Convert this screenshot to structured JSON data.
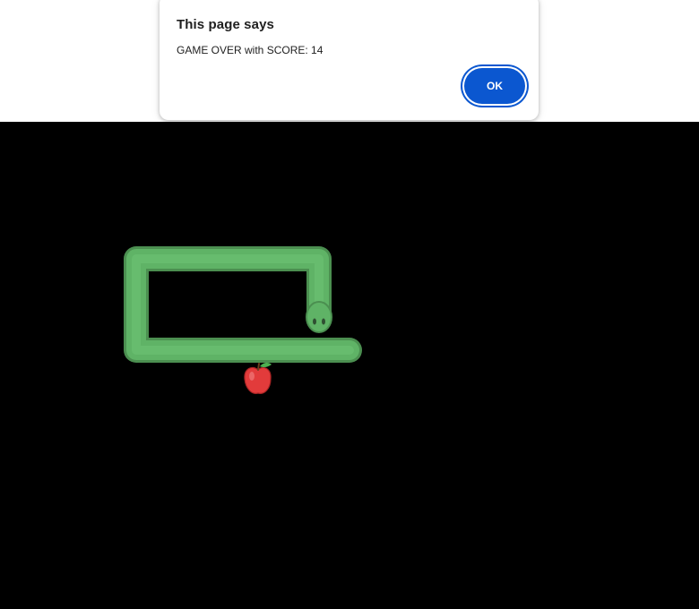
{
  "dialog": {
    "title": "This page says",
    "message": "GAME OVER with SCORE: 14",
    "ok_label": "OK"
  },
  "game": {
    "score": 14,
    "status": "game over",
    "background_color": "#000000",
    "snake_color": "#5fb366",
    "snake_outline_color": "#4b8f50",
    "apple_color": "#e23b3b",
    "apple_icon": "apple-icon",
    "snake_head_icon": "snake-head-icon"
  },
  "colors": {
    "accent": "#0b57d0"
  }
}
